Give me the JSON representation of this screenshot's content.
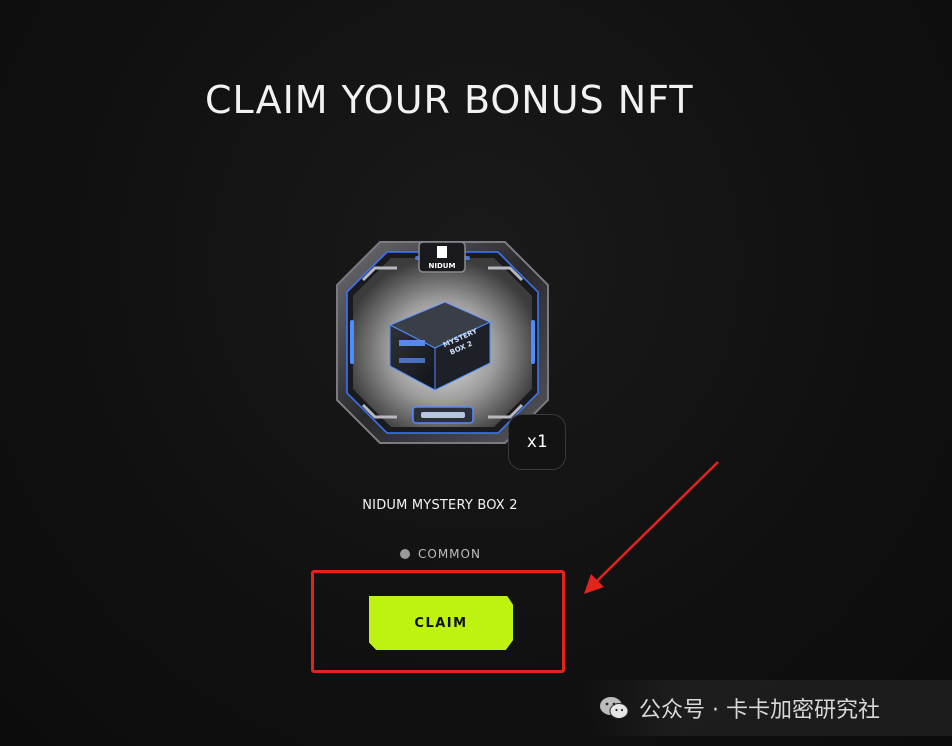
{
  "header": {
    "title": "CLAIM YOUR BONUS NFT"
  },
  "nft": {
    "name": "NIDUM MYSTERY BOX 2",
    "quantity": "x1",
    "rarity": "COMMON",
    "image_icon": "mystery-box-icon",
    "brand_top": "NIDUM",
    "box_label": "MYSTERY BOX 2"
  },
  "actions": {
    "claim_label": "CLAIM"
  },
  "annotation": {
    "highlight_color": "#e5231d"
  },
  "watermark": {
    "text": "公众号 · 卡卡加密研究社",
    "icon": "wechat-icon"
  },
  "colors": {
    "accent": "#bdf211",
    "background": "#111111",
    "glow": "#3b7bff"
  }
}
